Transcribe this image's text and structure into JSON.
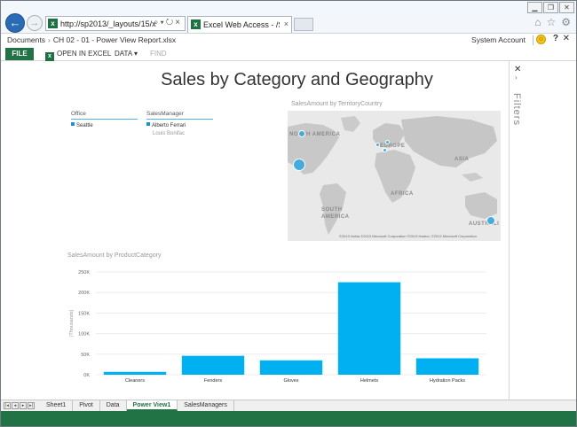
{
  "browser": {
    "url": "http://sp2013/_layouts/15/xlviewe",
    "tab_title": "Excel Web Access - /Shared...",
    "window_buttons": [
      "minimize",
      "restore",
      "close"
    ]
  },
  "sharepoint": {
    "breadcrumb_root": "Documents",
    "breadcrumb_file": "CH 02 - 01 - Power View Report.xlsx",
    "account": "System Account"
  },
  "ribbon": {
    "file": "FILE",
    "open_in_excel": "OPEN IN EXCEL",
    "data": "DATA",
    "find": "FIND"
  },
  "report": {
    "title": "Sales by Category and Geography"
  },
  "filters_pane": {
    "label": "Filters"
  },
  "slicers": [
    {
      "header": "Office",
      "items": [
        {
          "label": "Seattle",
          "selected": true
        }
      ]
    },
    {
      "header": "SalesManager",
      "items": [
        {
          "label": "Alberto Ferrari",
          "selected": true
        },
        {
          "label": "Louis Bonifac",
          "selected": false
        }
      ]
    }
  ],
  "map": {
    "title": "SalesAmount by TerritoryCountry",
    "labels": {
      "north_america": "NORTH AMERICA",
      "europe": "EUROPE",
      "asia": "ASIA",
      "africa": "AFRICA",
      "south_america": "SOUTH AMERICA",
      "australia": "AUSTRALI"
    },
    "copyright": "©2013 Nokia  ©2013 Microsoft Corporation  ©2013 Harbor, ©2013 Microsoft Corporation"
  },
  "chart_data": {
    "type": "bar",
    "title": "SalesAmount by ProductCategory",
    "ylabel": "(Thousands)",
    "categories": [
      "Cleaners",
      "Fenders",
      "Gloves",
      "Helmets",
      "Hydration Packs"
    ],
    "values": [
      7000,
      46000,
      35000,
      225000,
      40000
    ],
    "ylim": [
      0,
      250000
    ],
    "yticks": [
      0,
      50000,
      100000,
      150000,
      200000,
      250000
    ],
    "ytick_labels": [
      "0K",
      "50K",
      "100K",
      "150K",
      "200K",
      "250K"
    ],
    "bar_color": "#00b0f0",
    "grid": true
  },
  "sheets": {
    "tabs": [
      "Sheet1",
      "Pivot",
      "Data",
      "Power View1",
      "SalesManagers"
    ],
    "active": "Power View1"
  },
  "colors": {
    "excel_green": "#217346",
    "status_green": "#217346",
    "bar_blue": "#00b0f0"
  }
}
